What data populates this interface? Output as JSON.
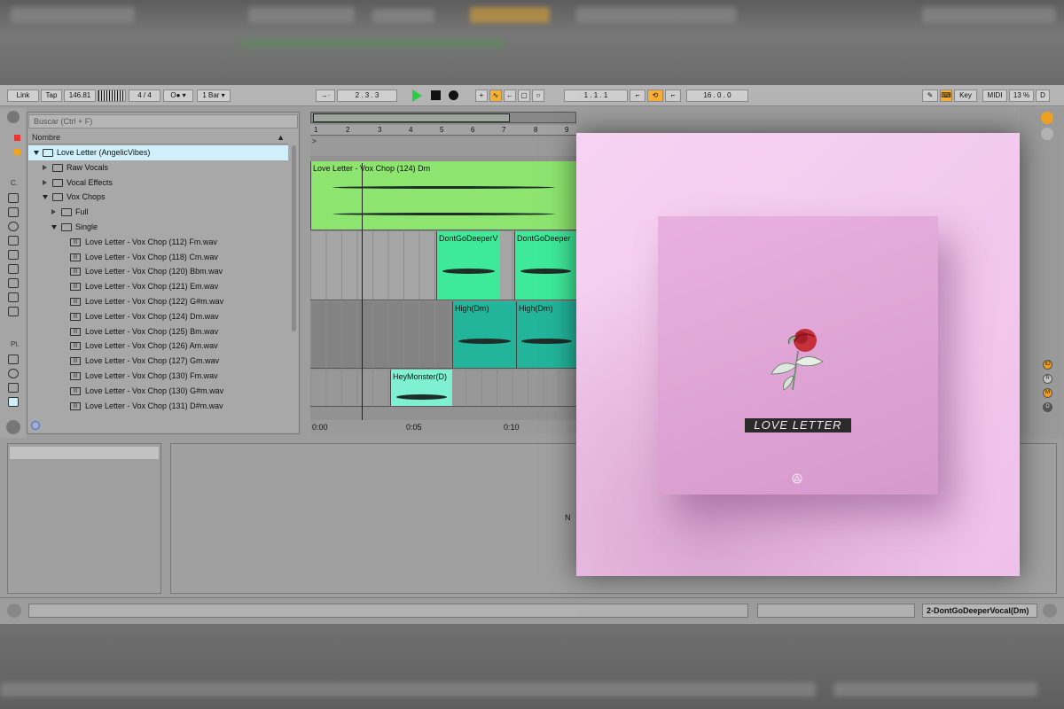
{
  "control_bar": {
    "link": "Link",
    "tap": "Tap",
    "tempo": "146.81",
    "time_signature": "4 / 4",
    "quantize": "1 Bar",
    "position": "2 .  3 .  3",
    "loop_start": "1 .  1 .  1",
    "loop_length": "16 .  0 .  0",
    "key": "Key",
    "midi": "MIDI",
    "cpu": "13 %",
    "d_button": "D"
  },
  "browser": {
    "search_placeholder": "Buscar (Ctrl + F)",
    "column_header": "Nombre",
    "sidebar_labels": {
      "collections": "C.",
      "places": "Pl."
    },
    "root": "Love Letter (AngelicVibes)",
    "folders": {
      "raw_vocals": "Raw Vocals",
      "vocal_effects": "Vocal Effects",
      "vox_chops": "Vox Chops",
      "full": "Full",
      "single": "Single"
    },
    "files": [
      "Love Letter - Vox Chop (112) Fm.wav",
      "Love Letter - Vox Chop (118) Cm.wav",
      "Love Letter - Vox Chop (120) Bbm.wav",
      "Love Letter - Vox Chop (121) Em.wav",
      "Love Letter - Vox Chop (122) G#m.wav",
      "Love Letter - Vox Chop (124) Dm.wav",
      "Love Letter - Vox Chop (125) Bm.wav",
      "Love Letter - Vox Chop (126) Am.wav",
      "Love Letter - Vox Chop (127) Gm.wav",
      "Love Letter - Vox Chop (130) Fm.wav",
      "Love Letter - Vox Chop (130) G#m.wav",
      "Love Letter - Vox Chop (131) D#m.wav"
    ]
  },
  "arrangement": {
    "bar_numbers": [
      "1",
      "2",
      "3",
      "4",
      "5",
      "6",
      "7",
      "8",
      "9"
    ],
    "clips": {
      "main": "Love Letter - Vox Chop (124) Dm",
      "dont_go_deeper_1": "DontGoDeeperV",
      "dont_go_deeper_2": "DontGoDeeper",
      "high_1": "High(Dm)",
      "high_2": "High(Dm)",
      "hey_monster": "HeyMonster(D)"
    },
    "time_labels": [
      "0:00",
      "0:05",
      "0:10"
    ]
  },
  "right_panel": {
    "buttons": [
      "IO",
      "R",
      "M",
      "D"
    ]
  },
  "detail": {
    "drop_hint_partial": "N"
  },
  "status": {
    "selected_clip": "2-DontGoDeeperVocal(Dm)"
  },
  "cover": {
    "title": "LOVE LETTER"
  },
  "colors": {
    "clip_green": "#8de56f",
    "clip_mint": "#3eea9a",
    "clip_teal": "#22b59c",
    "clip_aqua": "#7ff0d2",
    "accent_orange": "#f7b035",
    "cover_pink": "#f3c8ef"
  }
}
